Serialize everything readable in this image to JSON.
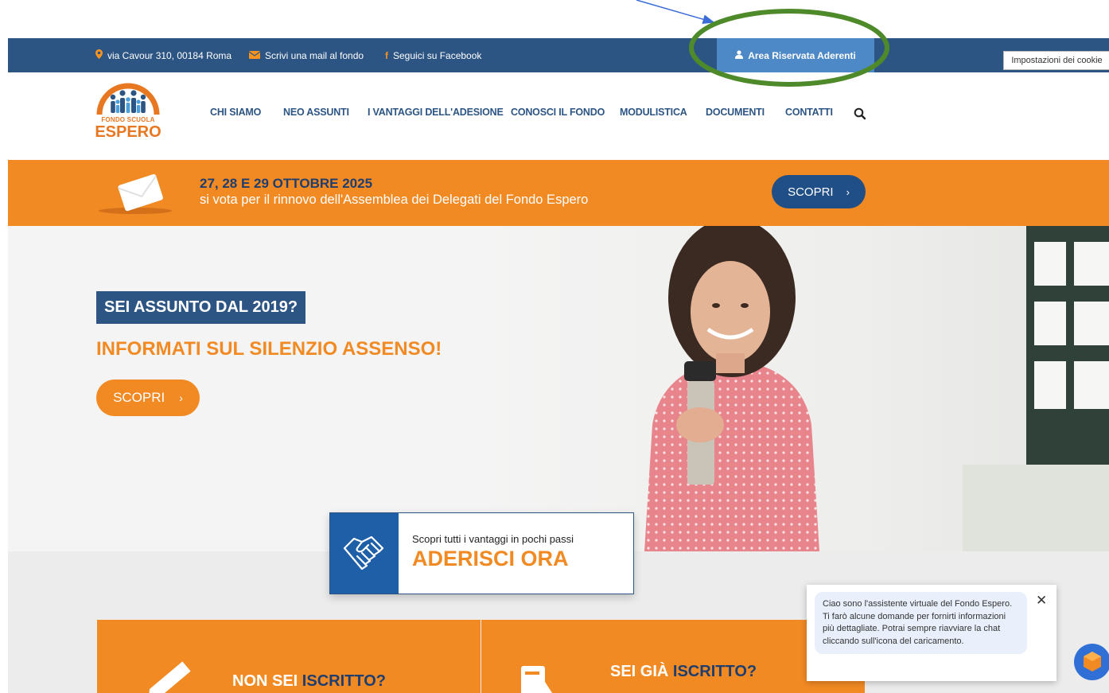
{
  "topbar": {
    "address": "via Cavour 310, 00184 Roma",
    "mail": "Scrivi una mail al fondo",
    "facebook": "Seguici su Facebook",
    "reserved_area": "Area Riservata Aderenti",
    "cookie_settings": "Impostazioni dei cookie"
  },
  "logo": {
    "line1": "FONDO SCUOLA",
    "line2": "ESPERO"
  },
  "nav": {
    "items": [
      "CHI SIAMO",
      "NEO ASSUNTI",
      "I VANTAGGI DELL'ADESIONE",
      "CONOSCI IL FONDO",
      "MODULISTICA",
      "DOCUMENTI",
      "CONTATTI"
    ]
  },
  "banner": {
    "title": "27, 28 E 29 OTTOBRE 2025",
    "subtitle": "si vota per il rinnovo dell'Assemblea dei Delegati del Fondo Espero",
    "button": "SCOPRI",
    "chevron": "›"
  },
  "hero": {
    "badge": "SEI ASSUNTO DAL 2019?",
    "headline": "INFORMATI SUL SILENZIO ASSENSO!",
    "button": "SCOPRI",
    "chevron": "›"
  },
  "adhere": {
    "subtitle": "Scopri tutti i vantaggi in pochi passi",
    "title": "ADERISCI ORA"
  },
  "boxes": {
    "left": {
      "prefix": "NON SEI ",
      "highlight": "ISCRITTO?"
    },
    "right": {
      "prefix": "SEI GIÀ ",
      "highlight": "ISCRITTO?"
    }
  },
  "chat": {
    "message": "Ciao sono l'assistente virtuale del Fondo Espero. Ti farò alcune domande per fornirti informazioni più dettagliate. Potrai sempre riavviare la chat cliccando sull'icona del caricamento.",
    "close": "✕"
  },
  "colors": {
    "navy": "#2d5584",
    "orange": "#f28a24",
    "annotation_green": "#4f8a2a",
    "annotation_arrow": "#3a6bd6"
  }
}
